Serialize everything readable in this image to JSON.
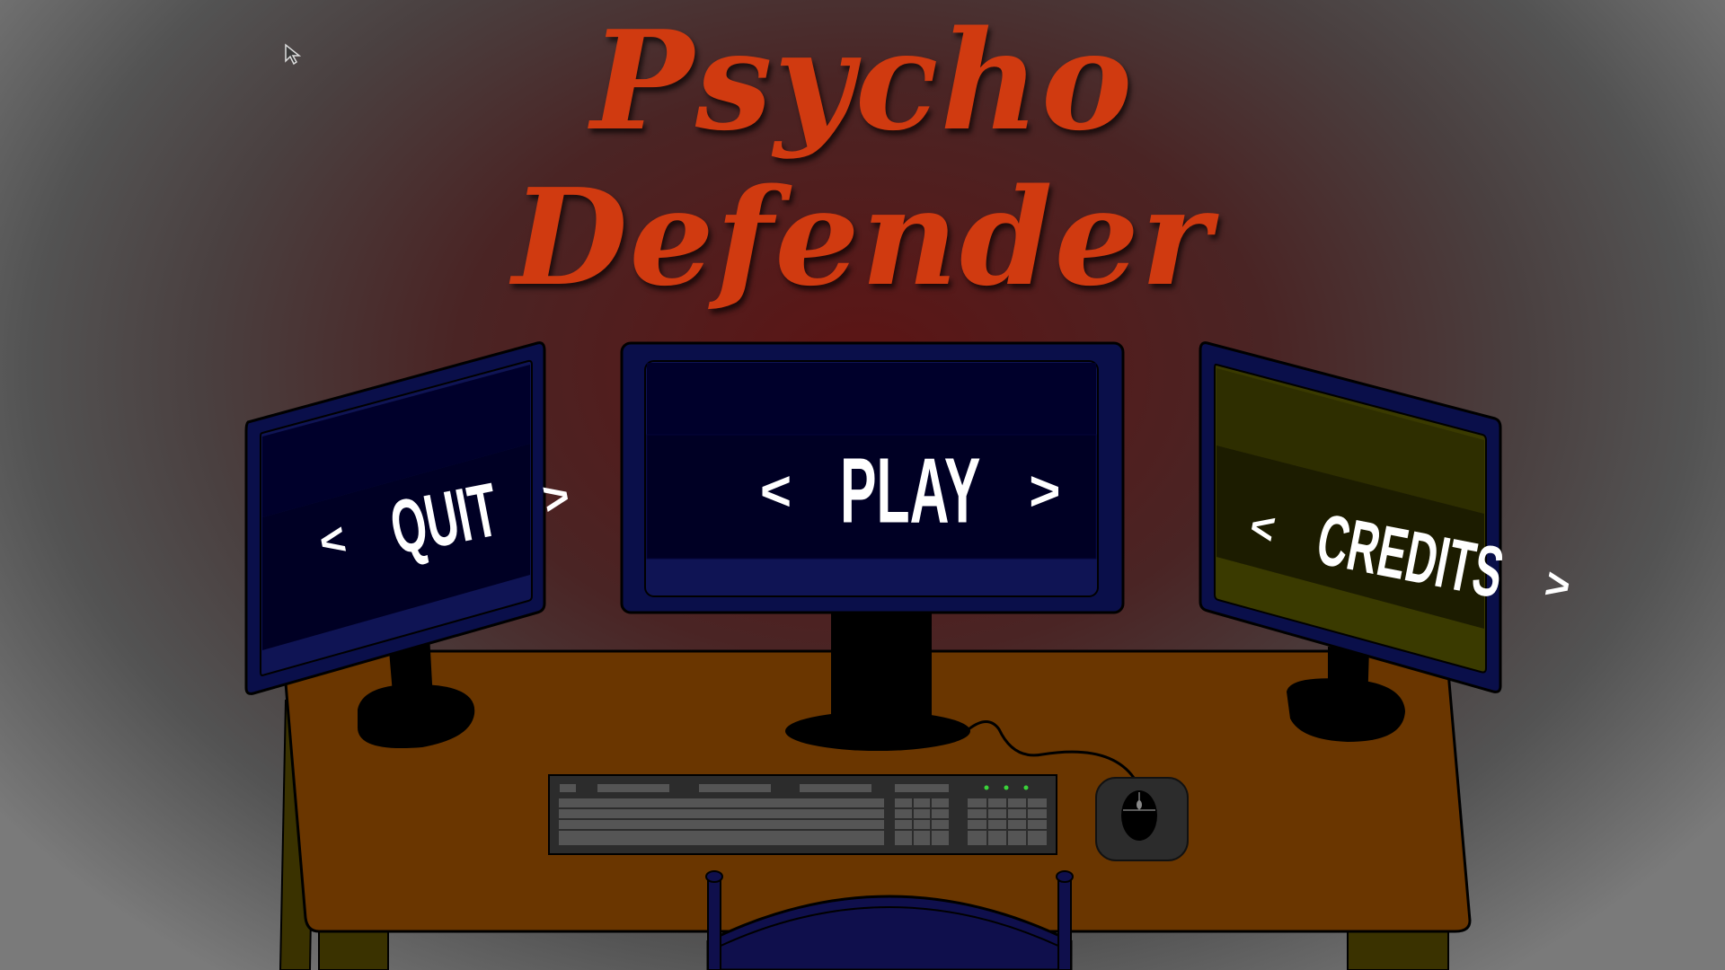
{
  "title": {
    "line1": "Psycho",
    "line2": "Defender"
  },
  "menu": {
    "play": {
      "label": "PLAY",
      "left": "<",
      "right": ">"
    },
    "quit": {
      "label": "QUIT",
      "left": "<",
      "right": ">"
    },
    "credits": {
      "label": "CREDITS",
      "left": "<",
      "right": ">"
    }
  },
  "colors": {
    "title": "#d03a10",
    "monitor_frame": "#0a0f4a",
    "screen_dark": "#00002b",
    "credits_screen": "#2e2e00",
    "desk": "#6a3600",
    "keyboard": "#2c2c2c",
    "chair": "#0f0f4c"
  },
  "icons": {
    "cursor": "arrow-pointer-icon"
  }
}
